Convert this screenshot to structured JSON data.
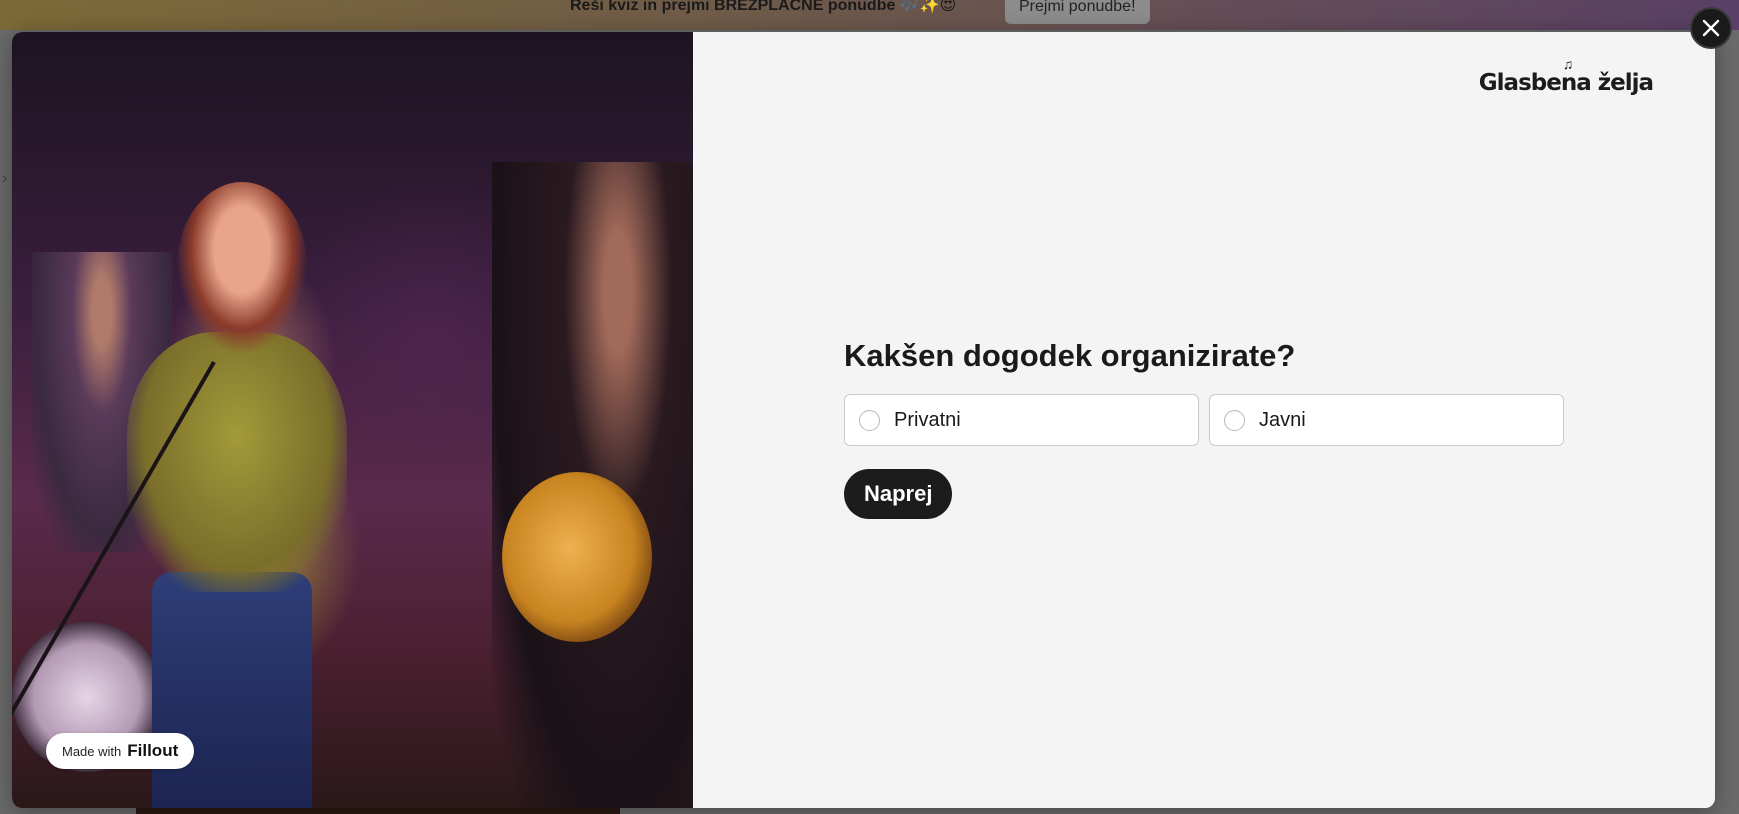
{
  "background": {
    "banner_text": "Reši kviz in prejmi BREZPLAČNE ponudbe 🎶✨😍",
    "banner_button_label": "Prejmi ponudbe!",
    "left_chevron": "›"
  },
  "modal": {
    "close_icon": "×",
    "logo": {
      "text": "Glasbena želja",
      "notes_icon": "♫"
    },
    "photo_alt": "Band performing on stage with singer pointing at camera",
    "badge": {
      "prefix": "Made with",
      "brand": "Fillout"
    },
    "form": {
      "question": "Kakšen dogodek organizirate?",
      "options": [
        {
          "label": "Privatni",
          "selected": false
        },
        {
          "label": "Javni",
          "selected": false
        }
      ],
      "next_label": "Naprej"
    }
  },
  "colors": {
    "panel_bg": "#f4f4f4",
    "primary_button": "#1c1c1c",
    "option_border": "#c9c9c9"
  }
}
